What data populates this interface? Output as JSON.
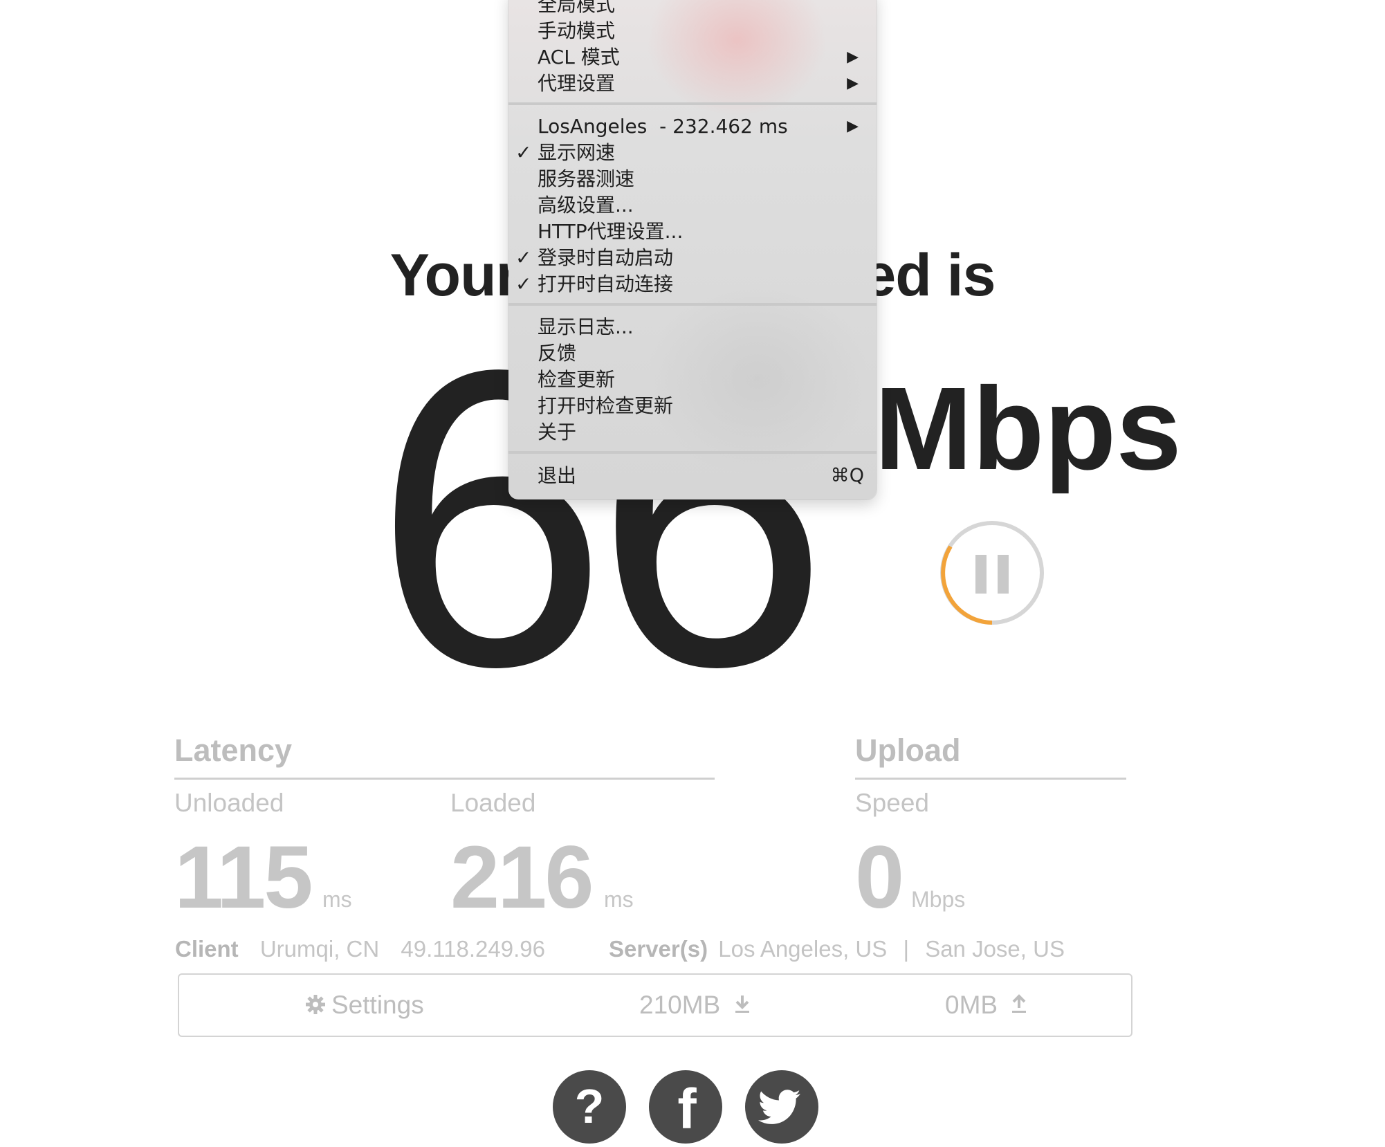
{
  "test": {
    "headline": "Your Internet speed is",
    "speed_value": "66",
    "speed_unit": "Mbps"
  },
  "latency": {
    "title": "Latency",
    "unloaded_label": "Unloaded",
    "unloaded_value": "115",
    "unloaded_unit": "ms",
    "loaded_label": "Loaded",
    "loaded_value": "216",
    "loaded_unit": "ms"
  },
  "upload": {
    "title": "Upload",
    "speed_label": "Speed",
    "speed_value": "0",
    "speed_unit": "Mbps"
  },
  "client": {
    "label": "Client",
    "location": "Urumqi, CN",
    "ip": "49.118.249.96"
  },
  "servers": {
    "label": "Server(s)",
    "primary": "Los Angeles, US",
    "divider": "|",
    "secondary": "San Jose, US"
  },
  "settings_bar": {
    "settings_label": "Settings",
    "downloaded": "210MB",
    "uploaded": "0MB"
  },
  "social": {
    "help": "?",
    "facebook": "f"
  },
  "menu": {
    "items_top": [
      {
        "label": "全局模式"
      },
      {
        "label": "手动模式"
      },
      {
        "label": "ACL 模式",
        "submenu": true
      },
      {
        "label": "代理设置",
        "submenu": true
      }
    ],
    "items_mid": [
      {
        "label": "LosAngeles  - 232.462 ms",
        "submenu": true
      },
      {
        "label": "显示网速",
        "checked": true
      },
      {
        "label": "服务器测速"
      },
      {
        "label": "高级设置..."
      },
      {
        "label": "HTTP代理设置..."
      },
      {
        "label": "登录时自动启动",
        "checked": true
      },
      {
        "label": "打开时自动连接",
        "checked": true
      }
    ],
    "items_low": [
      {
        "label": "显示日志..."
      },
      {
        "label": "反馈"
      },
      {
        "label": "检查更新"
      },
      {
        "label": "打开时检查更新"
      },
      {
        "label": "关于"
      }
    ],
    "quit": {
      "label": "退出",
      "shortcut": "⌘Q"
    },
    "check_glyph": "✓",
    "arrow_glyph": "▶"
  },
  "colors": {
    "text_dark": "#222222",
    "muted": "#c4c4c4",
    "accent_orange": "#f2a33a",
    "social_bg": "#4a4a4a"
  },
  "icons": [
    "pause-icon",
    "gear-icon",
    "download-arrow-icon",
    "upload-arrow-icon",
    "question-icon",
    "facebook-icon",
    "twitter-icon",
    "checkmark-icon",
    "submenu-arrow-icon"
  ]
}
